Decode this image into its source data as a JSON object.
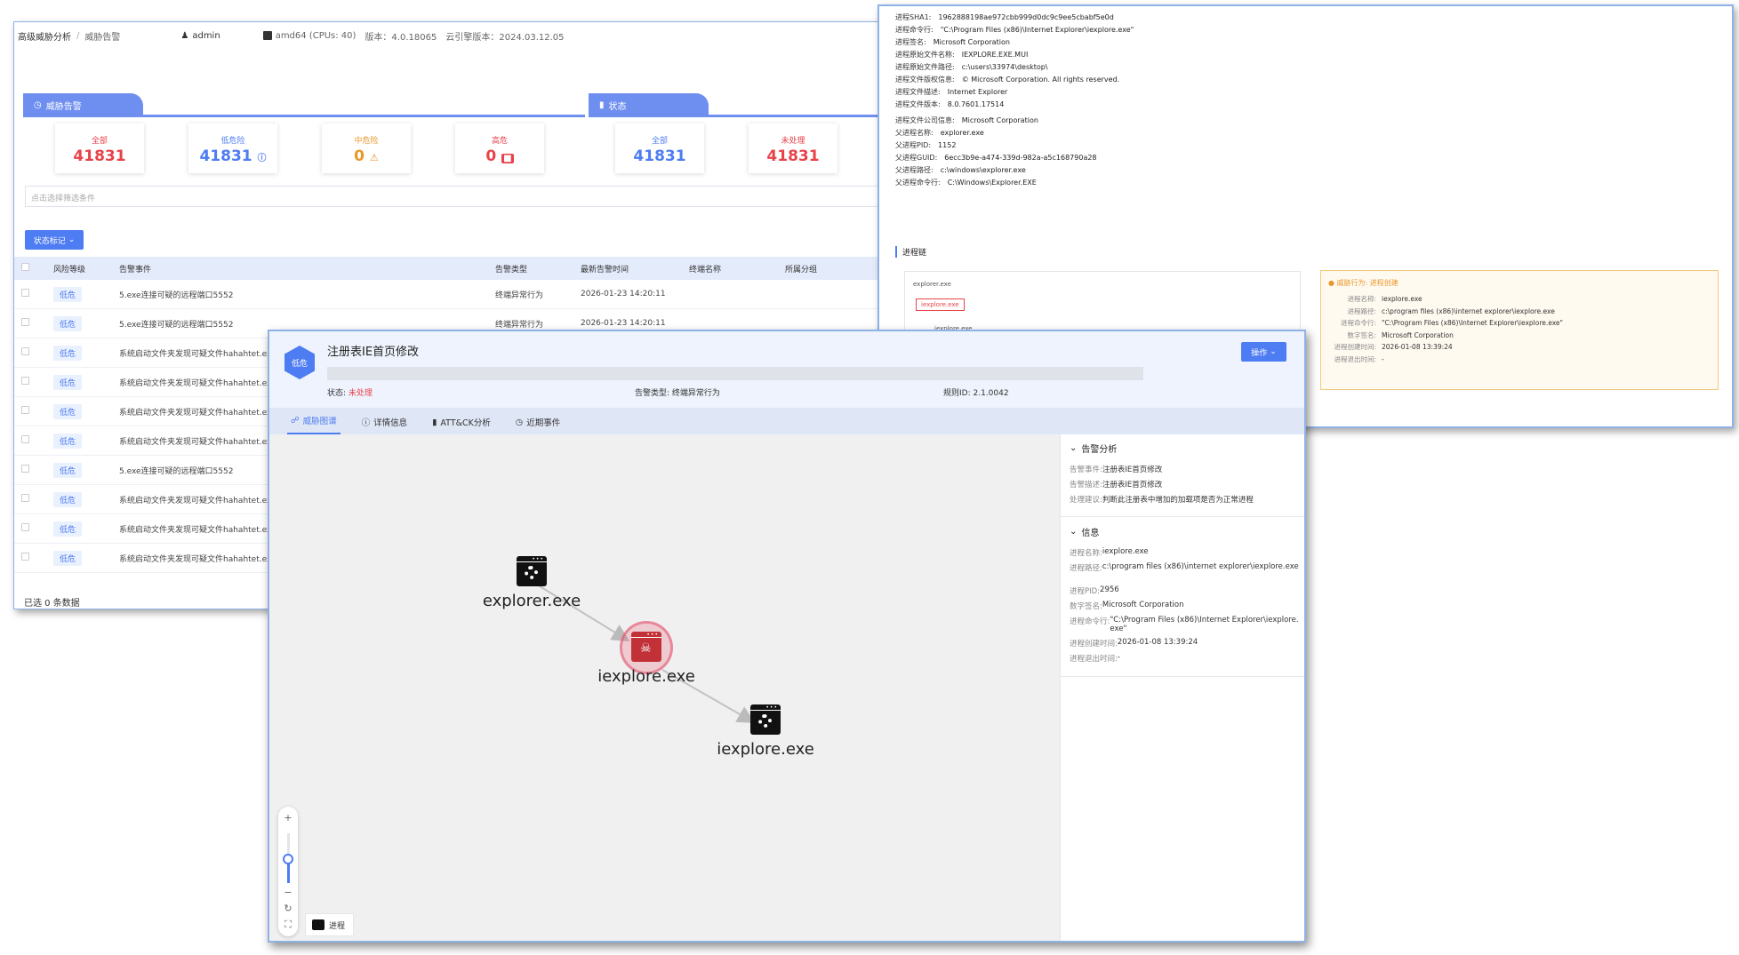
{
  "list_window": {
    "breadcrumb": [
      "高级威胁分析",
      "威胁告警"
    ],
    "user": "admin",
    "system": "amd64 (CPUs: 40)",
    "version": "版本：4.0.18065",
    "cloud_version": "云引擎版本：2024.03.12.05",
    "section_threat": "威胁告警",
    "section_status": "状态",
    "cards": [
      {
        "label": "全部",
        "value": "41831",
        "color": "#e8434a"
      },
      {
        "label": "低危险",
        "value": "41831",
        "color": "#4e7cf2"
      },
      {
        "label": "中危险",
        "value": "0",
        "color": "#e8972b"
      },
      {
        "label": "高危",
        "value": "0",
        "color": "#e8434a"
      }
    ],
    "status_cards": [
      {
        "label": "全部",
        "value": "41831",
        "color": "#4e7cf2"
      },
      {
        "label": "未处理",
        "value": "41831",
        "color": "#e8434a"
      }
    ],
    "filter_placeholder": "点击选择筛选条件",
    "status_button": "状态标记",
    "columns": [
      "风险等级",
      "告警事件",
      "告警类型",
      "最新告警时间",
      "终端名称",
      "所属分组"
    ],
    "rows": [
      {
        "risk": "低危",
        "event": "5.exe连接可疑的远程端口5552",
        "type": "终端异常行为",
        "time": "2026-01-23 14:20:11"
      },
      {
        "risk": "低危",
        "event": "5.exe连接可疑的远程端口5552",
        "type": "终端异常行为",
        "time": "2026-01-23 14:20:11"
      },
      {
        "risk": "低危",
        "event": "系统启动文件夹发现可疑文件hahahtet.exe",
        "type": "",
        "time": ""
      },
      {
        "risk": "低危",
        "event": "系统启动文件夹发现可疑文件hahahtet.exe",
        "type": "",
        "time": ""
      },
      {
        "risk": "低危",
        "event": "系统启动文件夹发现可疑文件hahahtet.exe",
        "type": "",
        "time": ""
      },
      {
        "risk": "低危",
        "event": "系统启动文件夹发现可疑文件hahahtet.exe",
        "type": "",
        "time": ""
      },
      {
        "risk": "低危",
        "event": "5.exe连接可疑的远程端口5552",
        "type": "",
        "time": ""
      },
      {
        "risk": "低危",
        "event": "系统启动文件夹发现可疑文件hahahtet.exe",
        "type": "",
        "time": ""
      },
      {
        "risk": "低危",
        "event": "系统启动文件夹发现可疑文件hahahtet.exe",
        "type": "",
        "time": ""
      },
      {
        "risk": "低危",
        "event": "系统启动文件夹发现可疑文件hahahtet.exe",
        "type": "",
        "time": ""
      }
    ],
    "footer": "已选 0 条数据"
  },
  "detail_window": {
    "fields": [
      {
        "k": "进程SHA1:",
        "v": "1962888198ae972cbb999d0dc9c9ee5cbabf5e0d"
      },
      {
        "k": "进程命令行:",
        "v": "\"C:\\Program Files (x86)\\Internet Explorer\\iexplore.exe\""
      },
      {
        "k": "进程签名:",
        "v": "Microsoft Corporation"
      },
      {
        "k": "进程原始文件名称:",
        "v": "IEXPLORE.EXE.MUI"
      },
      {
        "k": "进程原始文件路径:",
        "v": "c:\\users\\33974\\desktop\\"
      },
      {
        "k": "进程文件版权信息:",
        "v": "© Microsoft Corporation. All rights reserved."
      },
      {
        "k": "进程文件描述:",
        "v": "Internet Explorer"
      },
      {
        "k": "进程文件版本:",
        "v": "8.0.7601.17514"
      },
      {
        "k": "进程文件公司信息:",
        "v": "Microsoft Corporation"
      },
      {
        "k": "父进程名称:",
        "v": "explorer.exe"
      },
      {
        "k": "父进程PID:",
        "v": "1152"
      },
      {
        "k": "父进程GUID:",
        "v": "6ecc3b9e-a474-339d-982a-a5c168790a28"
      },
      {
        "k": "父进程路径:",
        "v": "c:\\windows\\explorer.exe"
      },
      {
        "k": "父进程命令行:",
        "v": "C:\\Windows\\Explorer.EXE"
      }
    ],
    "chain_title": "进程链",
    "chain_nodes": [
      "explorer.exe",
      "iexplore.exe",
      "iexplore.exe"
    ],
    "warn_title": "威胁行为: 进程创建",
    "warn_fields": [
      {
        "k": "进程名称:",
        "v": "iexplore.exe"
      },
      {
        "k": "进程路径:",
        "v": "c:\\program files (x86)\\internet explorer\\iexplore.exe"
      },
      {
        "k": "进程命令行:",
        "v": "\"C:\\Program Files (x86)\\Internet Explorer\\iexplore.exe\""
      },
      {
        "k": "数字签名:",
        "v": "Microsoft Corporation"
      },
      {
        "k": "进程创建时间:",
        "v": "2026-01-08 13:39:24"
      },
      {
        "k": "进程退出时间:",
        "v": "-"
      }
    ]
  },
  "graph_window": {
    "risk_badge": "低危",
    "title": "注册表IE首页修改",
    "status_label": "状态:",
    "status_value": "未处理",
    "alert_type": "告警类型: 终端异常行为",
    "rule_id": "规则ID: 2.1.0042",
    "op_button": "操作",
    "tabs": [
      "威胁图谱",
      "详情信息",
      "ATT&CK分析",
      "近期事件"
    ],
    "nodes": [
      "explorer.exe",
      "iexplore.exe",
      "iexplore.exe"
    ],
    "legend": "进程",
    "zoom": {
      "plus": "+",
      "minus": "−"
    },
    "analysis_title": "告警分析",
    "analysis": [
      {
        "k": "告警事件:",
        "v": "注册表IE首页修改"
      },
      {
        "k": "告警描述:",
        "v": "注册表IE首页修改"
      },
      {
        "k": "处理建议:",
        "v": "判断此注册表中增加的加载项是否为正常进程"
      }
    ],
    "info_title": "信息",
    "info": [
      {
        "k": "进程名称:",
        "v": "iexplore.exe"
      },
      {
        "k": "进程路径:",
        "v": "c:\\program files (x86)\\internet explorer\\iexplore.exe"
      },
      {
        "k": "进程PID:",
        "v": "2956"
      },
      {
        "k": "数字签名:",
        "v": "Microsoft Corporation"
      },
      {
        "k": "进程命令行:",
        "v": "\"C:\\Program Files (x86)\\Internet Explorer\\iexplore.exe\""
      },
      {
        "k": "进程创建时间:",
        "v": "2026-01-08 13:39:24"
      },
      {
        "k": "进程退出时间:",
        "v": "-"
      }
    ]
  },
  "colors": {
    "accent": "#4e7cf2",
    "danger": "#e8434a",
    "warning": "#e8972b"
  }
}
